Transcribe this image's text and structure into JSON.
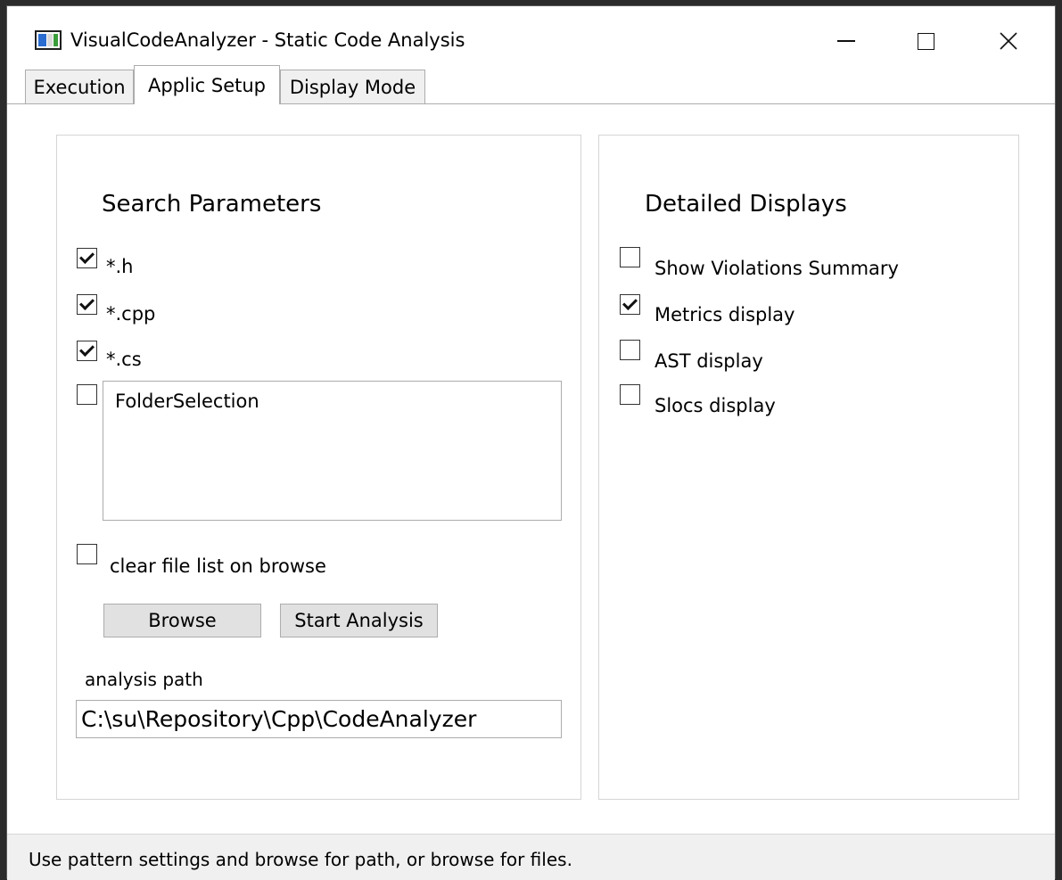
{
  "window": {
    "title": "VisualCodeAnalyzer - Static Code Analysis",
    "minimize_symbol": "",
    "maximize_symbol": "",
    "close_symbol": "✕"
  },
  "tabs": [
    {
      "label": "Execution",
      "active": false
    },
    {
      "label": "Applic Setup",
      "active": true
    },
    {
      "label": "Display Mode",
      "active": false
    }
  ],
  "search": {
    "heading": "Search Parameters",
    "patterns": [
      {
        "label": "*.h",
        "checked": true
      },
      {
        "label": "*.cpp",
        "checked": true
      },
      {
        "label": "*.cs",
        "checked": true
      }
    ],
    "folder_checked": false,
    "folder_list": [
      "FolderSelection"
    ],
    "clear_list_label": "clear file list on browse",
    "clear_list_checked": false,
    "browse_label": "Browse",
    "start_label": "Start Analysis",
    "path_label": "analysis path",
    "path_value": "C:\\su\\Repository\\Cpp\\CodeAnalyzer"
  },
  "displays": {
    "heading": "Detailed Displays",
    "options": [
      {
        "label": "Show Violations Summary",
        "checked": false
      },
      {
        "label": "Metrics display",
        "checked": true
      },
      {
        "label": "AST display",
        "checked": false
      },
      {
        "label": "Slocs display",
        "checked": false
      }
    ]
  },
  "status": {
    "text": "Use pattern settings and browse for path, or browse for files."
  }
}
